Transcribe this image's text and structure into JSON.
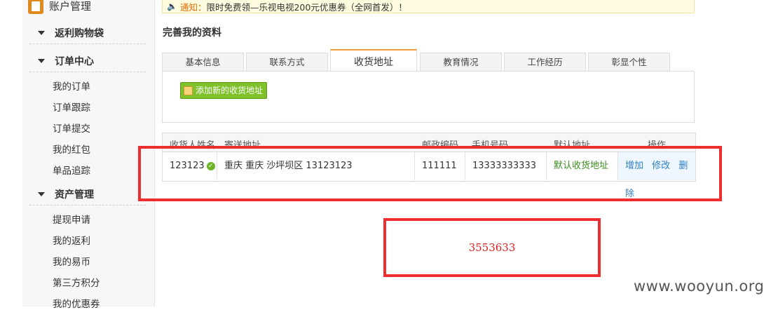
{
  "sidebar": {
    "account_title": "账户管理",
    "sections": [
      {
        "title": "返利购物袋",
        "items": []
      },
      {
        "title": "订单中心",
        "items": [
          "我的订单",
          "订单跟踪",
          "订单提交",
          "我的红包",
          "单品追踪"
        ]
      },
      {
        "title": "资产管理",
        "items": [
          "提现申请",
          "我的返利",
          "我的易币",
          "第三方积分",
          "我的优惠券"
        ]
      }
    ]
  },
  "notice": {
    "label": "通知：",
    "text": "限时免费领—乐视电视200元优惠券（全网首发）！"
  },
  "page_title": "完善我的资料",
  "tabs": [
    "基本信息",
    "联系方式",
    "收货地址",
    "教育情况",
    "工作经历",
    "彰显个性"
  ],
  "active_tab": "收货地址",
  "add_button": "添加新的收货地址",
  "table": {
    "headers": [
      "收货人姓名",
      "寄送地址",
      "邮政编码",
      "手机号码",
      "默认地址",
      "操作"
    ],
    "row": {
      "name": "123123",
      "address": "重庆 重庆 沙坪坝区 13123123",
      "zip": "111111",
      "phone": "13333333333",
      "default": "默认收货地址",
      "ops": [
        "增加",
        "修改",
        "删除"
      ]
    }
  },
  "annotation_id": "3553633",
  "watermark": "www.wooyun.org",
  "colors": {
    "accent": "#f29d38",
    "annotation": "#ee2e2e",
    "button": "#7ec12b"
  }
}
